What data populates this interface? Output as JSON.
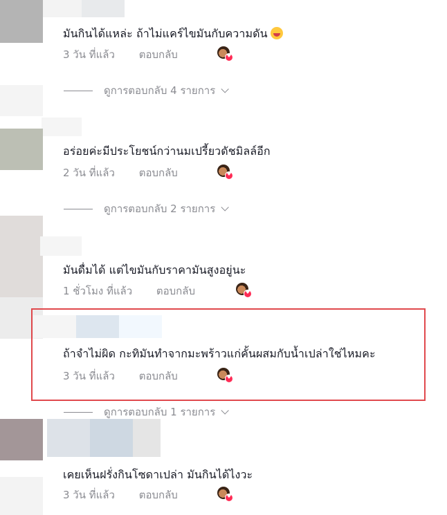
{
  "comments": [
    {
      "text": "มันกินได้แหล่ะ ถ้าไม่แคร์ไขมันกับความดัน",
      "emoji": "laughing-face-icon",
      "time": "3 วัน ที่แล้ว",
      "reply": "ตอบกลับ",
      "view_replies": "ดูการตอบกลับ 4 รายการ"
    },
    {
      "text": "อร่อยค่ะมีประโยชน์กว่านมเปรี้ยวดัชมิลล์อีก",
      "time": "2 วัน ที่แล้ว",
      "reply": "ตอบกลับ",
      "view_replies": "ดูการตอบกลับ 2 รายการ"
    },
    {
      "text": "มันดื่มได้ แต่ไขมันกับราคามันสูงอยู่นะ",
      "time": "1 ชั่วโมง ที่แล้ว",
      "reply": "ตอบกลับ"
    },
    {
      "text": "ถ้าจำไม่ผิด กะทิมันทำจากมะพร้าวแก่คั้นผสมกับน้ำเปล่าใช่ไหมคะ",
      "time": "3 วัน ที่แล้ว",
      "reply": "ตอบกลับ",
      "view_replies": "ดูการตอบกลับ 1 รายการ"
    },
    {
      "text": "เคยเห็นฝรั่งกินโซดาเปล่า มันกินได้ไงวะ",
      "time": "3 วัน ที่แล้ว",
      "reply": "ตอบกลับ"
    }
  ],
  "colors": {
    "highlight": "#e0484c",
    "muted": "#8a8b91",
    "heart": "#fe2c55"
  }
}
